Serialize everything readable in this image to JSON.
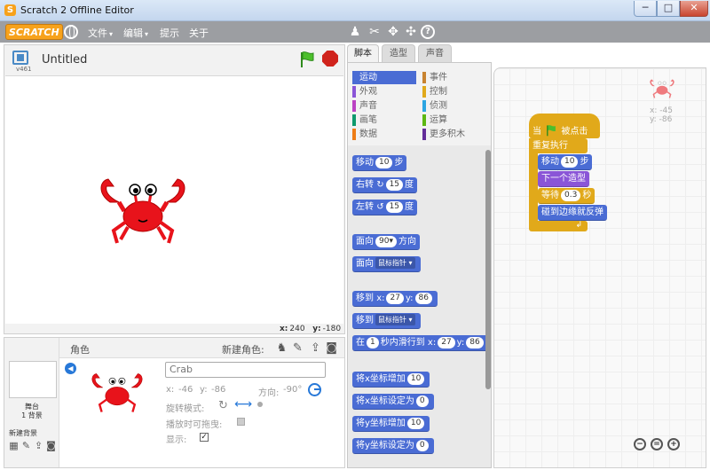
{
  "window": {
    "title": "Scratch 2 Offline Editor",
    "min": "─",
    "max": "□",
    "close": "✕"
  },
  "menubar": {
    "logo": "SCRATCH",
    "menus": [
      "文件",
      "编辑",
      "提示",
      "关于"
    ],
    "caret": "▾",
    "tools": [
      {
        "name": "duplicate-icon",
        "glyph": "♟"
      },
      {
        "name": "delete-icon",
        "glyph": "✂"
      },
      {
        "name": "grow-icon",
        "glyph": "✥"
      },
      {
        "name": "shrink-icon",
        "glyph": "✣"
      },
      {
        "name": "help-icon",
        "glyph": "?"
      }
    ]
  },
  "stage": {
    "version": "v461",
    "project_title": "Untitled",
    "mouse_x_label": "x:",
    "mouse_x": "240",
    "mouse_y_label": "y:",
    "mouse_y": "-180"
  },
  "sprites": {
    "header_label": "角色",
    "new_sprite_label": "新建角色:",
    "stage_label": "舞台",
    "backdrop_count": "1 背景",
    "new_backdrop_label": "新建背景",
    "selected": {
      "name": "Crab",
      "x_label": "x:",
      "x": "-46",
      "y_label": "y:",
      "y": "-86",
      "direction_label": "方向:",
      "direction": "-90°",
      "rotation_label": "旋转模式:",
      "draggable_label": "播放时可拖曳:",
      "show_label": "显示:",
      "show_checked": "✓"
    }
  },
  "tabs": [
    "脚本",
    "造型",
    "声音"
  ],
  "categories": [
    {
      "label": "运动",
      "color": "#4a6cd4",
      "active": true
    },
    {
      "label": "事件",
      "color": "#c88330"
    },
    {
      "label": "外观",
      "color": "#8a55d7"
    },
    {
      "label": "控制",
      "color": "#e1a91a"
    },
    {
      "label": "声音",
      "color": "#bb42c3"
    },
    {
      "label": "侦测",
      "color": "#2ca5e2"
    },
    {
      "label": "画笔",
      "color": "#0e9a6c"
    },
    {
      "label": "运算",
      "color": "#5cb712"
    },
    {
      "label": "数据",
      "color": "#ee7d16"
    },
    {
      "label": "更多积木",
      "color": "#632d99"
    }
  ],
  "palette": {
    "move": {
      "a": "移动",
      "v": "10",
      "b": "步"
    },
    "turn_right": {
      "a": "右转",
      "icon": "↻",
      "v": "15",
      "b": "度"
    },
    "turn_left": {
      "a": "左转",
      "icon": "↺",
      "v": "15",
      "b": "度"
    },
    "point_dir": {
      "a": "面向",
      "v": "90▾",
      "b": "方向"
    },
    "point_towards": {
      "a": "面向",
      "dd": "鼠标指针 ▾"
    },
    "goto_xy": {
      "a": "移到",
      "xl": "x:",
      "x": "27",
      "yl": "y:",
      "y": "86"
    },
    "goto": {
      "a": "移到",
      "dd": "鼠标指针 ▾"
    },
    "glide": {
      "a": "在",
      "v": "1",
      "b": "秒内滑行到",
      "xl": "x:",
      "x": "27",
      "yl": "y:",
      "y": "86"
    },
    "change_x": {
      "a": "将x坐标增加",
      "v": "10"
    },
    "set_x": {
      "a": "将x坐标设定为",
      "v": "0"
    },
    "change_y": {
      "a": "将y坐标增加",
      "v": "10"
    },
    "set_y": {
      "a": "将y坐标设定为",
      "v": "0"
    }
  },
  "script": {
    "hat_a": "当",
    "hat_b": "被点击",
    "forever": "重复执行",
    "move_a": "移动",
    "move_v": "10",
    "move_b": "步",
    "next_costume": "下一个造型",
    "wait_a": "等待",
    "wait_v": "0.3",
    "wait_b": "秒",
    "bounce": "碰到边缘就反弹",
    "loop_arrow": "↲"
  },
  "script_area": {
    "x_label": "x:",
    "x": "-45",
    "y_label": "y:",
    "y": "-86",
    "zoom_out": "−",
    "zoom_reset": "=",
    "zoom_in": "+"
  },
  "colors": {
    "motion": "#4a6cd4",
    "looks": "#8a55d7",
    "control": "#e1a91a",
    "crab": "#e8131b"
  }
}
